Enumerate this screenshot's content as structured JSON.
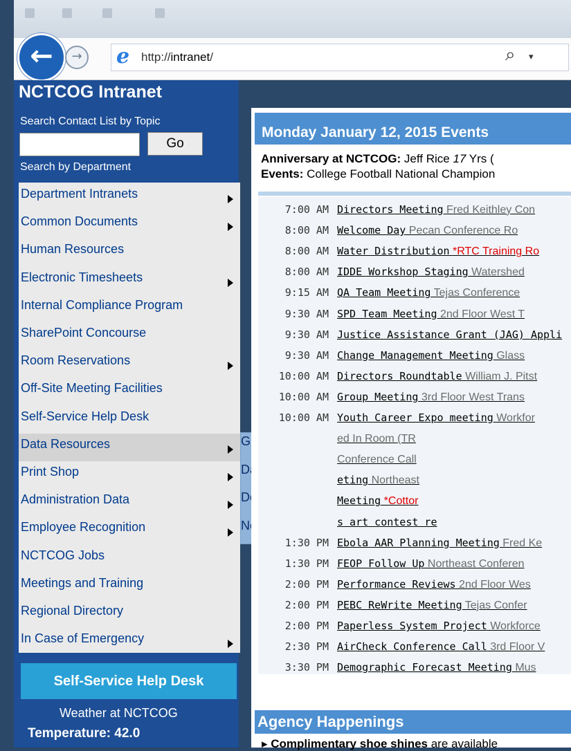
{
  "browser": {
    "url_plain": "http://",
    "url_bold": "intranet",
    "url_tail": "/",
    "back_glyph": "←",
    "forward_glyph": "→",
    "search_glyph": "⌕",
    "dropdown_glyph": "▾"
  },
  "sidebar": {
    "title": "NCTCOG Intranet",
    "search_label": "Search Contact List by Topic",
    "search_value": "",
    "go_label": "Go",
    "dept_label": "Search by Department",
    "items": [
      {
        "label": "Department Intranets",
        "arrow": true
      },
      {
        "label": "Common Documents",
        "arrow": true
      },
      {
        "label": "Human Resources",
        "arrow": false
      },
      {
        "label": "Electronic Timesheets",
        "arrow": true
      },
      {
        "label": "Internal Compliance Program",
        "arrow": false
      },
      {
        "label": "SharePoint Concourse",
        "arrow": false
      },
      {
        "label": "Room Reservations",
        "arrow": true
      },
      {
        "label": "Off-Site Meeting Facilities",
        "arrow": false
      },
      {
        "label": "Self-Service Help Desk",
        "arrow": false
      },
      {
        "label": "Data Resources",
        "arrow": true
      },
      {
        "label": "Print Shop",
        "arrow": true
      },
      {
        "label": "Administration Data",
        "arrow": true
      },
      {
        "label": "Employee Recognition",
        "arrow": true
      },
      {
        "label": "NCTCOG Jobs",
        "arrow": false
      },
      {
        "label": "Meetings and Training",
        "arrow": false
      },
      {
        "label": "Regional Directory",
        "arrow": false
      },
      {
        "label": "In Case of Emergency",
        "arrow": true
      }
    ],
    "flyout": [
      "GIS Guidance",
      "Data Handbook",
      "Demographic Handbook",
      "New User Guide"
    ],
    "helpdesk_button": "Self-Service Help Desk",
    "weather_title": "Weather at NCTCOG",
    "temperature": "Temperature:  42.0"
  },
  "events": {
    "header": "Monday January 12, 2015 Events",
    "anniversary_label": "Anniversary at NCTCOG:",
    "anniversary_text": " Jeff Rice ",
    "anniversary_years": "17",
    "anniversary_suffix": " Yrs (",
    "events_label": "Events:",
    "events_text": " College Football National Champion",
    "schedule": [
      {
        "time": "7:00 AM",
        "title": "Directors Meeting",
        "rest": " Fred Keithley Con",
        "red": false
      },
      {
        "time": "8:00 AM",
        "title": "Welcome Day",
        "rest": " Pecan Conference Ro",
        "red": false
      },
      {
        "time": "8:00 AM",
        "title": "Water Distribution",
        "rest": " *RTC Training Ro",
        "red": true
      },
      {
        "time": "8:00 AM",
        "title": "IDDE Workshop Staging",
        "rest": " Watershed",
        "red": false
      },
      {
        "time": "9:15 AM",
        "title": "QA Team Meeting",
        "rest": " Tejas Conference",
        "red": false
      },
      {
        "time": "9:30 AM",
        "title": "SPD Team Meeting",
        "rest": " 2nd Floor West T",
        "red": false
      },
      {
        "time": "9:30 AM",
        "title": "Justice Assistance Grant (JAG) Appli",
        "rest": "",
        "red": false
      },
      {
        "time": "9:30 AM",
        "title": "Change Management Meeting",
        "rest": " Glass",
        "red": false
      },
      {
        "time": "10:00 AM",
        "title": "Directors Roundtable",
        "rest": " William J. Pitst",
        "red": false
      },
      {
        "time": "10:00 AM",
        "title": "Group Meeting",
        "rest": " 3rd Floor West Trans",
        "red": false
      },
      {
        "time": "10:00 AM",
        "title": "Youth Career Expo meeting",
        "rest": " Workfor",
        "red": false
      },
      {
        "time": "",
        "title": "",
        "rest": "ed In Room (TR",
        "red": false
      },
      {
        "time": "",
        "title": "",
        "rest": "Conference Call",
        "red": false
      },
      {
        "time": "",
        "title": "eting",
        "rest": " Northeast",
        "red": false
      },
      {
        "time": "",
        "title": "Meeting",
        "rest": " *Cottor",
        "red": true
      },
      {
        "time": "",
        "title": "s art contest re",
        "rest": "",
        "red": false
      },
      {
        "time": "1:30 PM",
        "title": "Ebola AAR Planning Meeting",
        "rest": " Fred Ke",
        "red": false
      },
      {
        "time": "1:30 PM",
        "title": "FEOP Follow Up",
        "rest": " Northeast Conferen",
        "red": false
      },
      {
        "time": "2:00 PM",
        "title": "Performance Reviews",
        "rest": " 2nd Floor Wes",
        "red": false
      },
      {
        "time": "2:00 PM",
        "title": "PEBC ReWrite Meeting",
        "rest": " Tejas Confer",
        "red": false
      },
      {
        "time": "2:00 PM",
        "title": "Paperless System Project",
        "rest": " Workforce",
        "red": false
      },
      {
        "time": "2:30 PM",
        "title": "AirCheck Conference Call",
        "rest": " 3rd Floor V",
        "red": false
      },
      {
        "time": "3:30 PM",
        "title": "Demographic Forecast Meeting",
        "rest": " Mus",
        "red": false
      }
    ]
  },
  "agency": {
    "header": "Agency Happenings",
    "line_bold": "Complimentary shoe shines",
    "line_rest": " are available"
  }
}
